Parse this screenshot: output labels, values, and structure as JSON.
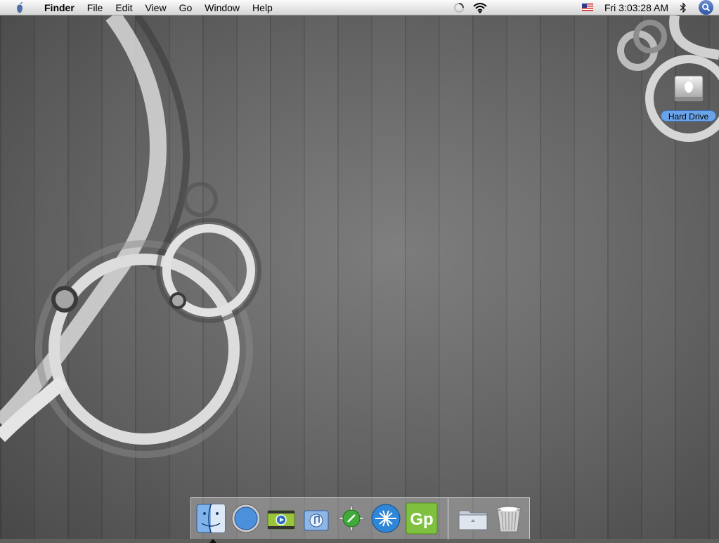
{
  "menubar": {
    "apple_menu_icon": "apple-icon",
    "app_name": "Finder",
    "menus": [
      "File",
      "Edit",
      "View",
      "Go",
      "Window",
      "Help"
    ],
    "status": {
      "spinner_icon": "progress-spinner-icon",
      "wifi_icon": "wifi-icon",
      "input_menu_icon": "us-flag-icon",
      "clock": "Fri 3:03:28 AM",
      "bluetooth_icon": "bluetooth-icon",
      "spotlight_icon": "spotlight-search-icon"
    }
  },
  "desktop": {
    "icons": [
      {
        "label": "Hard Drive",
        "icon": "hard-drive-icon",
        "selected": true
      }
    ]
  },
  "dock": {
    "apps": [
      {
        "name": "Finder",
        "icon": "finder-icon",
        "running": true
      },
      {
        "name": "Safari",
        "icon": "safari-icon",
        "running": false
      },
      {
        "name": "iMovie",
        "icon": "imovie-icon",
        "running": false
      },
      {
        "name": "iTunes",
        "icon": "itunes-icon",
        "running": false
      },
      {
        "name": "Compass",
        "icon": "compass-icon",
        "running": false
      },
      {
        "name": "Wire",
        "icon": "network-app-icon",
        "running": false
      },
      {
        "name": "Gp",
        "icon": "gp-app-icon",
        "running": false
      }
    ],
    "others": [
      {
        "name": "Applications folder",
        "icon": "folder-icon"
      },
      {
        "name": "Trash",
        "icon": "trash-icon"
      }
    ],
    "gp_label": "Gp"
  }
}
